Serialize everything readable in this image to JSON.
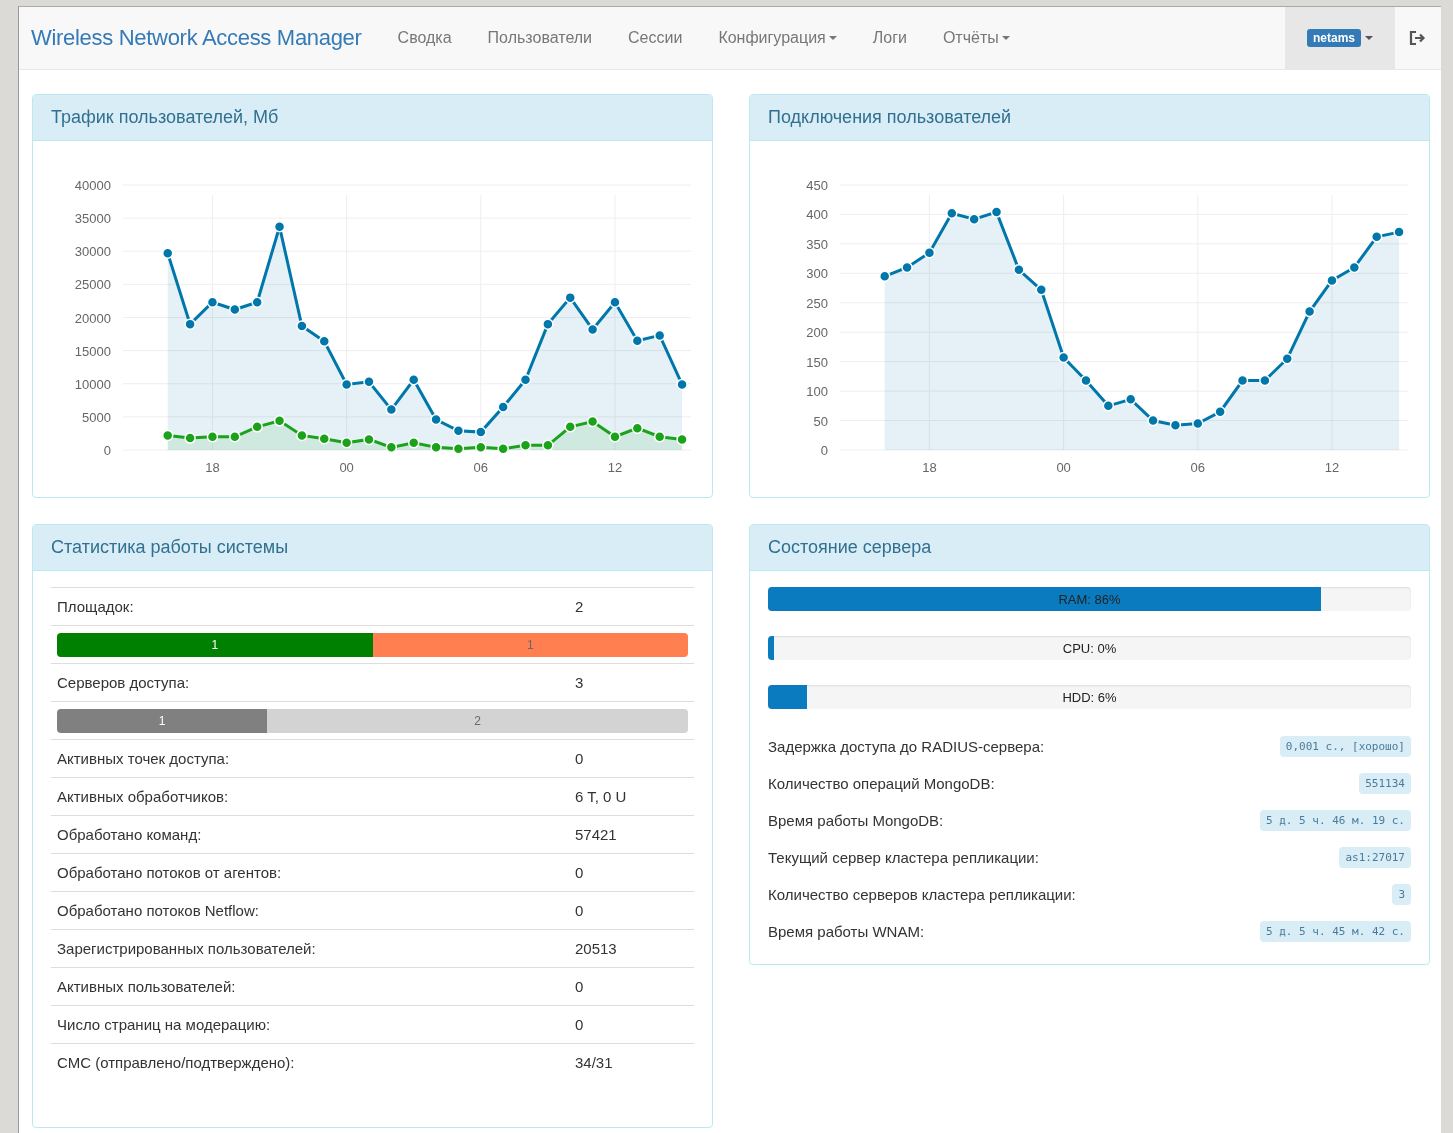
{
  "navbar": {
    "brand": "Wireless Network Access Manager",
    "items": [
      {
        "label": "Сводка",
        "dropdown": false
      },
      {
        "label": "Пользователи",
        "dropdown": false
      },
      {
        "label": "Сессии",
        "dropdown": false
      },
      {
        "label": "Конфигурация",
        "dropdown": true
      },
      {
        "label": "Логи",
        "dropdown": false
      },
      {
        "label": "Отчёты",
        "dropdown": true
      }
    ],
    "user": {
      "label": "netams",
      "selected": true
    }
  },
  "traffic_panel": {
    "title": "Трафик пользователей, Мб",
    "chart_data": {
      "type": "area",
      "grid": true,
      "categories": [
        null,
        null,
        "18",
        null,
        null,
        null,
        null,
        null,
        "00",
        null,
        null,
        null,
        null,
        null,
        "06",
        null,
        null,
        null,
        null,
        null,
        "12",
        null,
        null,
        null
      ],
      "ylim": [
        0,
        40000
      ],
      "yticks": [
        0,
        5000,
        10000,
        15000,
        20000,
        25000,
        30000,
        35000,
        40000
      ],
      "series": [
        {
          "color": "#0077aa",
          "values": [
            29700,
            19000,
            22300,
            21200,
            22300,
            33700,
            18700,
            16400,
            9900,
            10300,
            6100,
            10600,
            4600,
            2900,
            2700,
            6500,
            10600,
            19000,
            23000,
            18200,
            22300,
            16500,
            17300,
            9900
          ]
        },
        {
          "color": "#1aa31a",
          "values": [
            2200,
            1800,
            2000,
            2000,
            3500,
            4400,
            2200,
            1700,
            1100,
            1600,
            400,
            1100,
            400,
            200,
            400,
            200,
            700,
            700,
            3500,
            4300,
            2000,
            3300,
            2000,
            1600
          ]
        }
      ]
    }
  },
  "connections_panel": {
    "title": "Подключения пользователей",
    "chart_data": {
      "type": "area",
      "grid": true,
      "categories": [
        null,
        null,
        "18",
        null,
        null,
        null,
        null,
        null,
        "00",
        null,
        null,
        null,
        null,
        null,
        "06",
        null,
        null,
        null,
        null,
        null,
        "12",
        null,
        null,
        null
      ],
      "ylim": [
        0,
        450
      ],
      "yticks": [
        0,
        50,
        100,
        150,
        200,
        250,
        300,
        350,
        400,
        450
      ],
      "series": [
        {
          "color": "#0077aa",
          "values": [
            295,
            310,
            335,
            402,
            392,
            404,
            306,
            272,
            157,
            118,
            75,
            86,
            50,
            42,
            45,
            65,
            118,
            118,
            155,
            235,
            288,
            310,
            362,
            370
          ]
        }
      ]
    }
  },
  "stats_panel": {
    "title": "Статистика работы системы",
    "rows": [
      {
        "kind": "text",
        "label": "Площадок:",
        "value": "2"
      },
      {
        "kind": "bar",
        "segments": [
          {
            "label": "1",
            "color": "#008000",
            "level": 0.5
          },
          {
            "label": "1",
            "color": "#ff7f50",
            "level": 0.5
          }
        ]
      },
      {
        "kind": "text",
        "label": "Серверов доступа:",
        "value": "3"
      },
      {
        "kind": "bar",
        "segments": [
          {
            "label": "1",
            "color": "#808080",
            "level": 0.333
          },
          {
            "label": "2",
            "color": "#d3d3d3",
            "level": 0.667
          }
        ]
      },
      {
        "kind": "text",
        "label": "Активных точек доступа:",
        "value": "0"
      },
      {
        "kind": "text",
        "label": "Активных обработчиков:",
        "value": "6 T, 0 U"
      },
      {
        "kind": "text",
        "label": "Обработано команд:",
        "value": "57421"
      },
      {
        "kind": "text",
        "label": "Обработано потоков от агентов:",
        "value": "0"
      },
      {
        "kind": "text",
        "label": "Обработано потоков Netflow:",
        "value": "0"
      },
      {
        "kind": "text",
        "label": "Зарегистрированных пользователей:",
        "value": "20513"
      },
      {
        "kind": "text",
        "label": "Активных пользователей:",
        "value": "0"
      },
      {
        "kind": "text",
        "label": "Число страниц на модерацию:",
        "value": "0"
      },
      {
        "kind": "text",
        "label": "СМС (отправлено/подтверждено):",
        "value": "34/31"
      }
    ]
  },
  "server_panel": {
    "title": "Состояние сервера",
    "meters": [
      {
        "label": "RAM: 86%",
        "level": 0.86
      },
      {
        "label": "CPU: 0%",
        "level": 0.01
      },
      {
        "label": "HDD: 6%",
        "level": 0.06
      }
    ],
    "facts": [
      {
        "label": "Задержка доступа до RADIUS-сервера:",
        "value": "0,001 с., [хорошо]"
      },
      {
        "label": "Количество операций MongoDB:",
        "value": "551134"
      },
      {
        "label": "Время работы MongoDB:",
        "value": "5 д. 5 ч. 46 м. 19 с."
      },
      {
        "label": "Текущий сервер кластера репликации:",
        "value": "as1:27017"
      },
      {
        "label": "Количество серверов кластера репликации:",
        "value": "3"
      },
      {
        "label": "Время работы WNAM:",
        "value": "5 д. 5 ч. 45 м. 42 с."
      }
    ]
  }
}
